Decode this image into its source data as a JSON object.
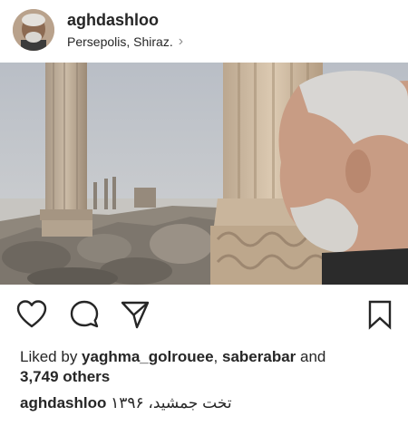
{
  "post": {
    "username": "aghdashloo",
    "location": "Persepolis, Shiraz.",
    "likes": {
      "prefix": "Liked by ",
      "user1": "yaghma_golrouee",
      "separator": ", ",
      "user2": "saberabar",
      "conjunction": " and",
      "others_count": "3,749",
      "others_label": " others"
    },
    "caption": {
      "username": "aghdashloo",
      "text": "تخت جمشید، ۱۳۹۶"
    }
  },
  "icons": {
    "location_chevron": "chevron-right-icon",
    "like": "heart-icon",
    "comment": "comment-bubble-icon",
    "share": "paper-plane-icon",
    "save": "bookmark-icon"
  },
  "colors": {
    "text": "#262626",
    "secondary": "#8e8e8e",
    "background": "#ffffff"
  }
}
